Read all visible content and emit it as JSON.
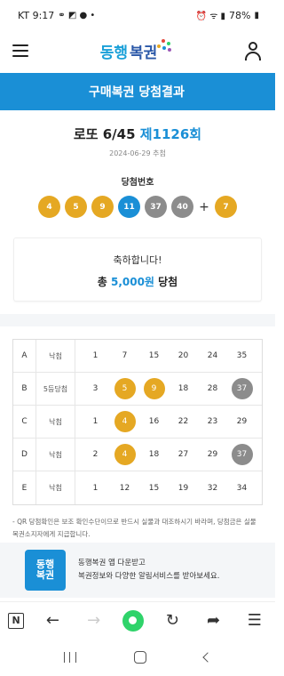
{
  "status_bar": {
    "carrier_time": "KT 9:17",
    "battery": "78%"
  },
  "header": {
    "logo_text_1": "동행",
    "logo_text_2": "복권",
    "menu_icon": "hamburger-icon",
    "account_icon": "person-icon"
  },
  "banner": {
    "title": "구매복권 당첨결과"
  },
  "result": {
    "game_name": "로또 6/45",
    "round": "제1126회",
    "draw_date": "2024-06-29 추첨",
    "win_label": "당첨번호",
    "numbers": [
      "4",
      "5",
      "9",
      "11",
      "37",
      "40"
    ],
    "plus": "+",
    "bonus": "7",
    "ball_colors": {
      "yellow": "#e5a823",
      "blue": "#1a8fd6",
      "gray": "#8c8c8c"
    }
  },
  "congrats": {
    "line1": "축하합니다!",
    "prefix": "총 ",
    "amount": "5,000원",
    "suffix": " 당첨"
  },
  "games": [
    {
      "key": "A",
      "result": "낙첨",
      "numbers": [
        "1",
        "7",
        "15",
        "20",
        "24",
        "35"
      ],
      "hits": []
    },
    {
      "key": "B",
      "result": "5등당첨",
      "numbers": [
        "3",
        "5",
        "9",
        "18",
        "28",
        "37"
      ],
      "hits": [
        "5",
        "9"
      ],
      "bonus_hits": [
        "37"
      ]
    },
    {
      "key": "C",
      "result": "낙첨",
      "numbers": [
        "1",
        "4",
        "16",
        "22",
        "23",
        "29"
      ],
      "hits": [
        "4"
      ]
    },
    {
      "key": "D",
      "result": "낙첨",
      "numbers": [
        "2",
        "4",
        "18",
        "27",
        "29",
        "37"
      ],
      "hits": [
        "4"
      ],
      "bonus_hits": [
        "37"
      ]
    },
    {
      "key": "E",
      "result": "낙첨",
      "numbers": [
        "1",
        "12",
        "15",
        "19",
        "32",
        "34"
      ],
      "hits": []
    }
  ],
  "notice": "- QR 당첨확인은 보조 확인수단이므로 반드시 실물과 대조하시기 바라며, 당첨금은 실물 복권소지자에게 지급합니다.",
  "promo": {
    "icon_line1": "동행",
    "icon_line2": "복권",
    "line1": "동행복권 앱 다운받고",
    "line2": "복권정보와 다양한 알림서비스를 받아보세요."
  },
  "browser_bar": {
    "n_label": "N"
  }
}
